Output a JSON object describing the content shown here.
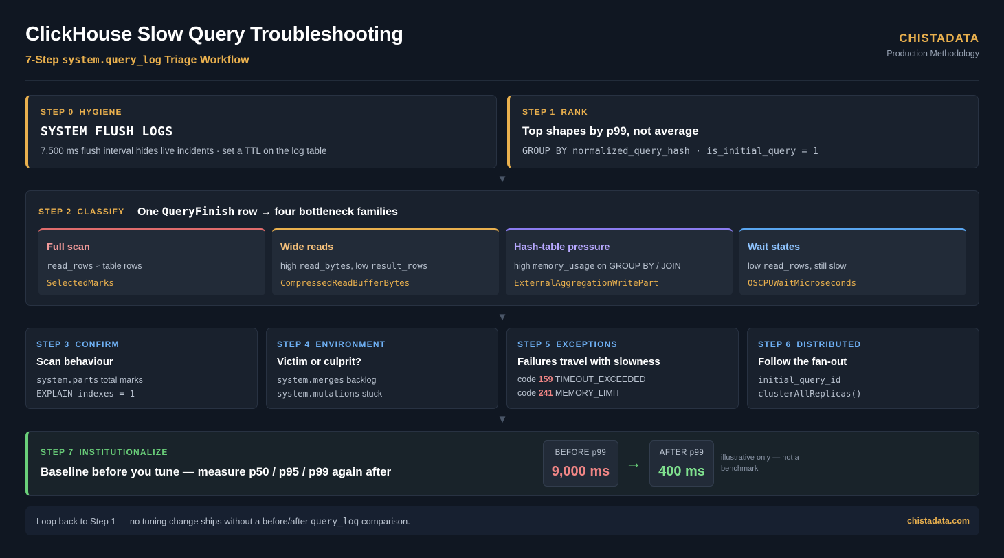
{
  "header": {
    "title": "ClickHouse Slow Query Troubleshooting",
    "subtitle_prefix": "7-Step ",
    "subtitle_code": "system.query_log",
    "subtitle_suffix": " Triage Workflow",
    "brand": "CHISTADATA",
    "brand_sub": "Production Methodology"
  },
  "arrow_glyph": "▼",
  "step0": {
    "num": "STEP 0",
    "tag": "HYGIENE",
    "head": "SYSTEM FLUSH LOGS",
    "desc": "7,500 ms flush interval hides live incidents · set a TTL on the log table"
  },
  "step1": {
    "num": "STEP 1",
    "tag": "RANK",
    "head": "Top shapes by p99, not average",
    "desc": "GROUP BY normalized_query_hash · is_initial_query = 1"
  },
  "step2": {
    "num": "STEP 2",
    "tag": "CLASSIFY",
    "head_pre": "One ",
    "head_code": "QueryFinish",
    "head_post": " row → four bottleneck families",
    "families": [
      {
        "name": "Full scan",
        "desc_code": "read_rows",
        "desc_text": " ≈ table rows",
        "metric": "SelectedMarks",
        "color": "#e06c6c",
        "name_color": "#f29a9a"
      },
      {
        "name": "Wide reads",
        "desc_pre": "high ",
        "desc_code": "read_bytes",
        "desc_mid": ", low ",
        "desc_code2": "result_rows",
        "metric": "CompressedReadBufferBytes",
        "color": "#e9b04e",
        "name_color": "#f5c07a"
      },
      {
        "name": "Hash-table pressure",
        "desc_pre": "high ",
        "desc_code": "memory_usage",
        "desc_text": " on GROUP BY / JOIN",
        "metric": "ExternalAggregationWritePart",
        "color": "#8b7cf0",
        "name_color": "#b7a8ff"
      },
      {
        "name": "Wait states",
        "desc_pre": "low ",
        "desc_code": "read_rows",
        "desc_text": ", still slow",
        "metric": "OSCPUWaitMicroseconds",
        "color": "#5aa6f0",
        "name_color": "#8fc4ff"
      }
    ]
  },
  "step3": {
    "num": "STEP 3",
    "tag": "CONFIRM",
    "head": "Scan behaviour",
    "l1_code": "system.parts",
    "l1_text": " total marks",
    "l2_code": "EXPLAIN indexes = 1"
  },
  "step4": {
    "num": "STEP 4",
    "tag": "ENVIRONMENT",
    "head": "Victim or culprit?",
    "l1_code": "system.merges",
    "l1_text": " backlog",
    "l2_code": "system.mutations",
    "l2_text": " stuck"
  },
  "step5": {
    "num": "STEP 5",
    "tag": "EXCEPTIONS",
    "head": "Failures travel with slowness",
    "l1_pre": "code ",
    "l1_code": "159",
    "l1_text": " TIMEOUT_EXCEEDED",
    "l2_pre": "code ",
    "l2_code": "241",
    "l2_text": " MEMORY_LIMIT"
  },
  "step6": {
    "num": "STEP 6",
    "tag": "DISTRIBUTED",
    "head": "Follow the fan-out",
    "l1_code": "initial_query_id",
    "l2_code": "clusterAllReplicas()"
  },
  "step7": {
    "num": "STEP 7",
    "tag": "INSTITUTIONALIZE",
    "head": "Baseline before you tune — measure p50 / p95 / p99 again after",
    "before_label": "BEFORE p99",
    "before_value": "9,000 ms",
    "arrow": "→",
    "after_label": "AFTER p99",
    "after_value": "400 ms",
    "note": "illustrative only — not a benchmark"
  },
  "footer": {
    "text_pre": "Loop back to Step 1 — no tuning change ships without a before/after ",
    "text_code": "query_log",
    "text_post": " comparison.",
    "url": "chistadata.com"
  },
  "colors": {
    "accent_gold": "#e9b04e",
    "accent_blue": "#6fb1f5",
    "accent_green": "#6ad07a",
    "accent_red": "#f08585"
  }
}
